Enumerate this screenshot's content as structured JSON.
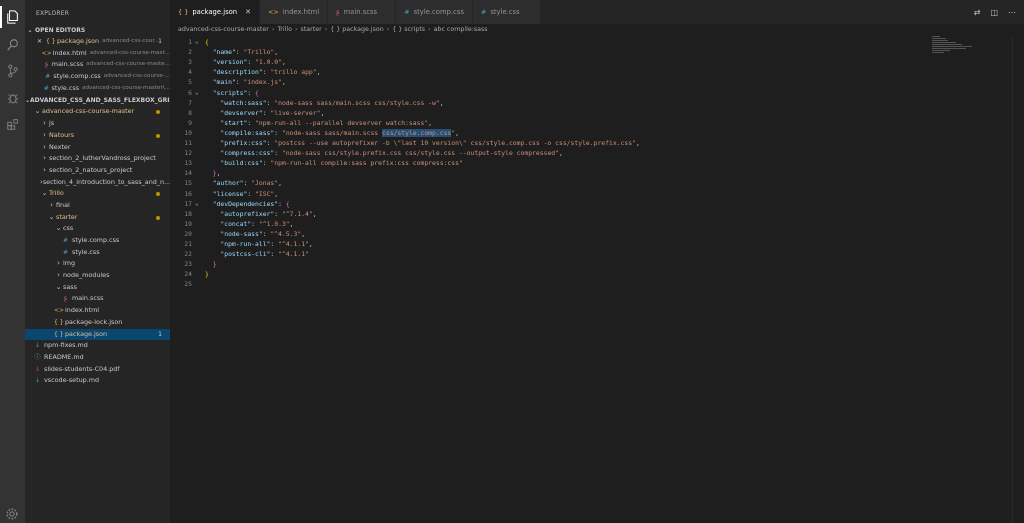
{
  "explorer": {
    "title": "EXPLORER",
    "open_editors_title": "OPEN EDITORS",
    "open_editors": [
      {
        "name": "package.json",
        "desc": "advanced-css-cour...",
        "badge": "1",
        "icon": "{ }",
        "close": "✕",
        "kind": "json"
      },
      {
        "name": "index.html",
        "desc": "advanced-css-course-mast...",
        "icon": "<>",
        "kind": "html"
      },
      {
        "name": "main.scss",
        "desc": "advanced-css-course-maste...",
        "icon": "ʂ",
        "kind": "scss"
      },
      {
        "name": "style.comp.css",
        "desc": "advanced-css-course-...",
        "icon": "#",
        "kind": "css"
      },
      {
        "name": "style.css",
        "desc": "advanced-css-course-master\\...",
        "icon": "#",
        "kind": "css"
      }
    ],
    "workspace_title": "ADVANCED_CSS_AND_SASS_FLEXBOX_GRID_A...",
    "tree": [
      {
        "label": "advanced-css-course-master",
        "chev": "⌄",
        "mod": true,
        "dot": true
      },
      {
        "label": "js",
        "chev": "›"
      },
      {
        "label": "Natours",
        "chev": "›",
        "mod": true,
        "dot": true
      },
      {
        "label": "Nexter",
        "chev": "›"
      },
      {
        "label": "section_2_lutherVandross_project",
        "chev": "›"
      },
      {
        "label": "section_2_natours_project",
        "chev": "›"
      },
      {
        "label": "section_4_introduction_to_sass_and_n...",
        "chev": "›"
      },
      {
        "label": "Trillo",
        "chev": "⌄",
        "mod": true,
        "dot": true
      },
      {
        "label": "final",
        "chev": "›"
      },
      {
        "label": "starter",
        "chev": "⌄",
        "mod": true,
        "dot": true
      },
      {
        "label": "css",
        "chev": "⌄"
      },
      {
        "label": "style.comp.css",
        "icon": "#",
        "kind": "css"
      },
      {
        "label": "style.css",
        "icon": "#",
        "kind": "css"
      },
      {
        "label": "img",
        "chev": "›"
      },
      {
        "label": "node_modules",
        "chev": "›"
      },
      {
        "label": "sass",
        "chev": "⌄"
      },
      {
        "label": "main.scss",
        "icon": "ʂ",
        "kind": "scss"
      },
      {
        "label": "index.html",
        "icon": "<>",
        "kind": "html"
      },
      {
        "label": "package-lock.json",
        "icon": "{ }",
        "kind": "json"
      },
      {
        "label": "package.json",
        "icon": "{ }",
        "kind": "json",
        "active": true,
        "badge": "1",
        "mod": true
      },
      {
        "label": "npm-fixes.md",
        "icon": "↓",
        "kind": "md"
      },
      {
        "label": "README.md",
        "icon": "ⓘ",
        "kind": "info"
      },
      {
        "label": "slides-students-C04.pdf",
        "icon": "⅄",
        "kind": "pdf"
      },
      {
        "label": "vscode-setup.md",
        "icon": "↓",
        "kind": "md"
      }
    ]
  },
  "tabs": [
    {
      "label": "package.json",
      "icon": "{ }",
      "kind": "json",
      "active": true,
      "close": "✕"
    },
    {
      "label": "index.html",
      "icon": "<>",
      "kind": "html"
    },
    {
      "label": "main.scss",
      "icon": "ʂ",
      "kind": "scss"
    },
    {
      "label": "style.comp.css",
      "icon": "#",
      "kind": "css"
    },
    {
      "label": "style.css",
      "icon": "#",
      "kind": "css"
    }
  ],
  "tab_actions": [
    "split-compare-icon",
    "split-editor-icon",
    "more-icon"
  ],
  "breadcrumb": [
    {
      "label": "advanced-css-course-master"
    },
    {
      "label": "Trillo"
    },
    {
      "label": "starter"
    },
    {
      "label": "{ } package.json"
    },
    {
      "label": "{ } scripts"
    },
    {
      "label": "abc compile:sass"
    }
  ],
  "code_lines": [
    {
      "n": "1",
      "fold": "⌄",
      "html": "<span class='b'>{</span>"
    },
    {
      "n": "2",
      "html": "  <span class='k'>\"name\"</span><span class='p'>: </span><span class='s'>\"Trillo\"</span><span class='p'>,</span>"
    },
    {
      "n": "3",
      "html": "  <span class='k'>\"version\"</span><span class='p'>: </span><span class='s'>\"1.0.0\"</span><span class='p'>,</span>"
    },
    {
      "n": "4",
      "html": "  <span class='k'>\"description\"</span><span class='p'>: </span><span class='s'>\"trillo app\"</span><span class='p'>,</span>"
    },
    {
      "n": "5",
      "html": "  <span class='k'>\"main\"</span><span class='p'>: </span><span class='s'>\"index.js\"</span><span class='p'>,</span>"
    },
    {
      "n": "6",
      "fold": "⌄",
      "html": "  <span class='k'>\"scripts\"</span><span class='p'>: </span><span class='b2'>{</span>"
    },
    {
      "n": "7",
      "html": "    <span class='k'>\"watch:sass\"</span><span class='p'>: </span><span class='s'>\"node-sass sass/main.scss css/style.css -w\"</span><span class='p'>,</span>"
    },
    {
      "n": "8",
      "html": "    <span class='k'>\"devserver\"</span><span class='p'>: </span><span class='s'>\"live-server\"</span><span class='p'>,</span>"
    },
    {
      "n": "9",
      "html": "    <span class='k'>\"start\"</span><span class='p'>: </span><span class='s'>\"npm-run-all --parallel devserver watch:sass\"</span><span class='p'>,</span>"
    },
    {
      "n": "10",
      "html": "    <span class='k'>\"compile:sass\"</span><span class='p'>: </span><span class='s'>\"node-sass sass/main.scss <span class='sel'>css/style.comp.css</span>\"</span><span class='p'>,</span>"
    },
    {
      "n": "11",
      "html": "    <span class='k'>\"prefix:css\"</span><span class='p'>: </span><span class='s'>\"postcss --use autoprefixer -b \\\"last 10 version\\\" css/style.comp.css -o css/style.prefix.css\"</span><span class='p'>,</span>"
    },
    {
      "n": "12",
      "html": "    <span class='k'>\"compress:css\"</span><span class='p'>: </span><span class='s'>\"node-sass css/style.prefix.css css/style.css --output-style compressed\"</span><span class='p'>,</span>"
    },
    {
      "n": "13",
      "html": "    <span class='k'>\"build:css\"</span><span class='p'>: </span><span class='s'>\"npm-run-all compile:sass prefix:css compress:css\"</span>"
    },
    {
      "n": "14",
      "html": "  <span class='b2'>}</span><span class='p'>,</span>"
    },
    {
      "n": "15",
      "html": "  <span class='k'>\"author\"</span><span class='p'>: </span><span class='s'>\"Jonas\"</span><span class='p'>,</span>"
    },
    {
      "n": "16",
      "html": "  <span class='k'>\"license\"</span><span class='p'>: </span><span class='s'>\"ISC\"</span><span class='p'>,</span>"
    },
    {
      "n": "17",
      "fold": "⌄",
      "html": "  <span class='k'>\"devDependencies\"</span><span class='p'>: </span><span class='b2'>{</span>"
    },
    {
      "n": "18",
      "html": "    <span class='k'>\"autoprefixer\"</span><span class='p'>: </span><span class='s'>\"^7.1.4\"</span><span class='p'>,</span>"
    },
    {
      "n": "19",
      "html": "    <span class='k'>\"concat\"</span><span class='p'>: </span><span class='s'>\"^1.0.3\"</span><span class='p'>,</span>"
    },
    {
      "n": "20",
      "html": "    <span class='k'>\"node-sass\"</span><span class='p'>: </span><span class='s'>\"^4.5.3\"</span><span class='p'>,</span>"
    },
    {
      "n": "21",
      "html": "    <span class='k'>\"npm-run-all\"</span><span class='p'>: </span><span class='s'>\"^4.1.1\"</span><span class='p'>,</span>"
    },
    {
      "n": "22",
      "html": "    <span class='k'>\"postcss-cli\"</span><span class='p'>: </span><span class='s'>\"^4.1.1\"</span>"
    },
    {
      "n": "23",
      "html": "  <span class='b2'>}</span>"
    },
    {
      "n": "24",
      "html": "<span class='b'>}</span>"
    },
    {
      "n": "25",
      "html": ""
    }
  ],
  "colors": {
    "accent": "#007acc",
    "active_row": "#094771",
    "modified": "#e2c08d"
  }
}
